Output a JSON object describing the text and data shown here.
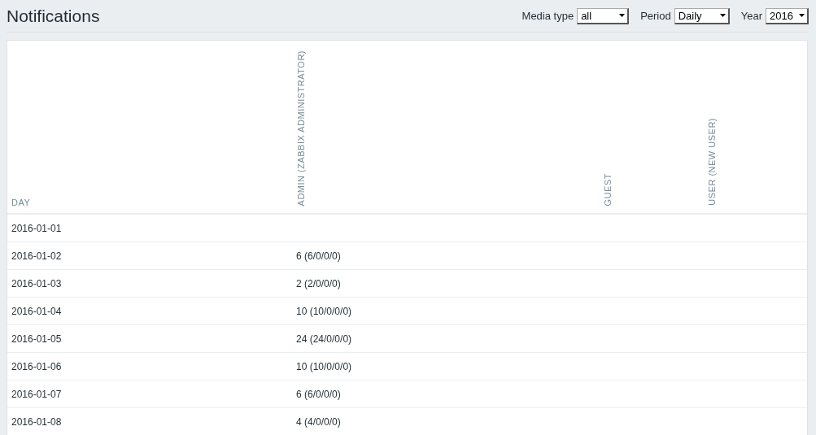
{
  "page": {
    "title": "Notifications"
  },
  "filters": [
    {
      "label": "Media type",
      "value": "all"
    },
    {
      "label": "Period",
      "value": "Daily"
    },
    {
      "label": "Year",
      "value": "2016"
    }
  ],
  "table": {
    "columns": [
      "DAY",
      "ADMIN (ZABBIX ADMINISTRATOR)",
      "GUEST",
      "USER (NEW USER)"
    ],
    "rows": [
      {
        "cells": [
          "2016-01-01"
        ]
      },
      {
        "cells": [
          "2016-01-02",
          "6 (6/0/0/0)"
        ]
      },
      {
        "cells": [
          "2016-01-03",
          "2 (2/0/0/0)"
        ]
      },
      {
        "cells": [
          "2016-01-04",
          "10 (10/0/0/0)"
        ]
      },
      {
        "cells": [
          "2016-01-05",
          "24 (24/0/0/0)"
        ]
      },
      {
        "cells": [
          "2016-01-06",
          "10 (10/0/0/0)"
        ]
      },
      {
        "cells": [
          "2016-01-07",
          "6 (6/0/0/0)"
        ]
      },
      {
        "cells": [
          "2016-01-08",
          "4 (4/0/0/0)"
        ]
      }
    ]
  }
}
